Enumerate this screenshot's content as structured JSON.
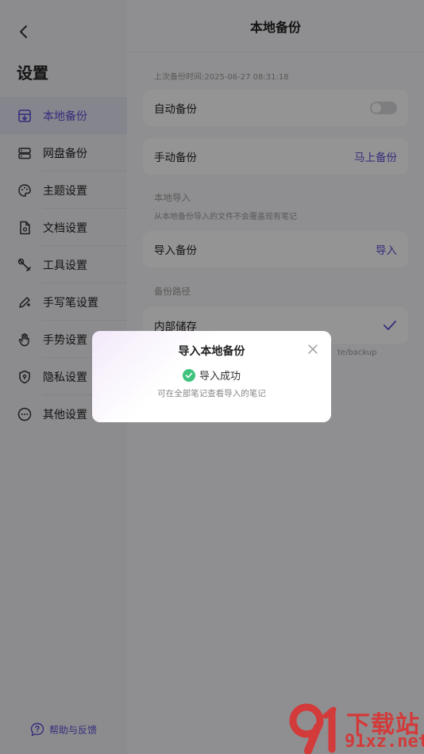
{
  "sidebar": {
    "title": "设置",
    "items": [
      {
        "label": "本地备份",
        "icon": "local-backup-icon",
        "active": true
      },
      {
        "label": "网盘备份",
        "icon": "cloud-drive-icon",
        "active": false
      },
      {
        "label": "主题设置",
        "icon": "palette-icon",
        "active": false
      },
      {
        "label": "文档设置",
        "icon": "document-icon",
        "active": false
      },
      {
        "label": "工具设置",
        "icon": "wrench-icon",
        "active": false
      },
      {
        "label": "手写笔设置",
        "icon": "pen-icon",
        "active": false
      },
      {
        "label": "手势设置",
        "icon": "hand-gesture-icon",
        "active": false
      },
      {
        "label": "隐私设置",
        "icon": "shield-icon",
        "active": false
      },
      {
        "label": "其他设置",
        "icon": "more-icon",
        "active": false
      }
    ],
    "help_label": "帮助与反馈"
  },
  "main": {
    "title": "本地备份",
    "last_backup": "上次备份时间:2025-06-27 08:31:18",
    "auto_backup_label": "自动备份",
    "auto_backup_enabled": false,
    "manual_backup_label": "手动备份",
    "manual_backup_action": "马上备份",
    "local_import_section": "本地导入",
    "local_import_note": "从本地备份导入的文件不会覆盖现有笔记",
    "import_backup_label": "导入备份",
    "import_backup_action": "导入",
    "backup_path_section": "备份路径",
    "internal_storage_label": "内部储存",
    "internal_storage_path_partial": "te/backup"
  },
  "dialog": {
    "title": "导入本地备份",
    "status": "导入成功",
    "note": "可在全部笔记查看导入的笔记"
  },
  "watermark": {
    "top": "下载站",
    "bottom": "91xz.net"
  },
  "colors": {
    "accent": "#5b4fd6",
    "success": "#3ec27c",
    "watermark": "#d33a3a"
  }
}
